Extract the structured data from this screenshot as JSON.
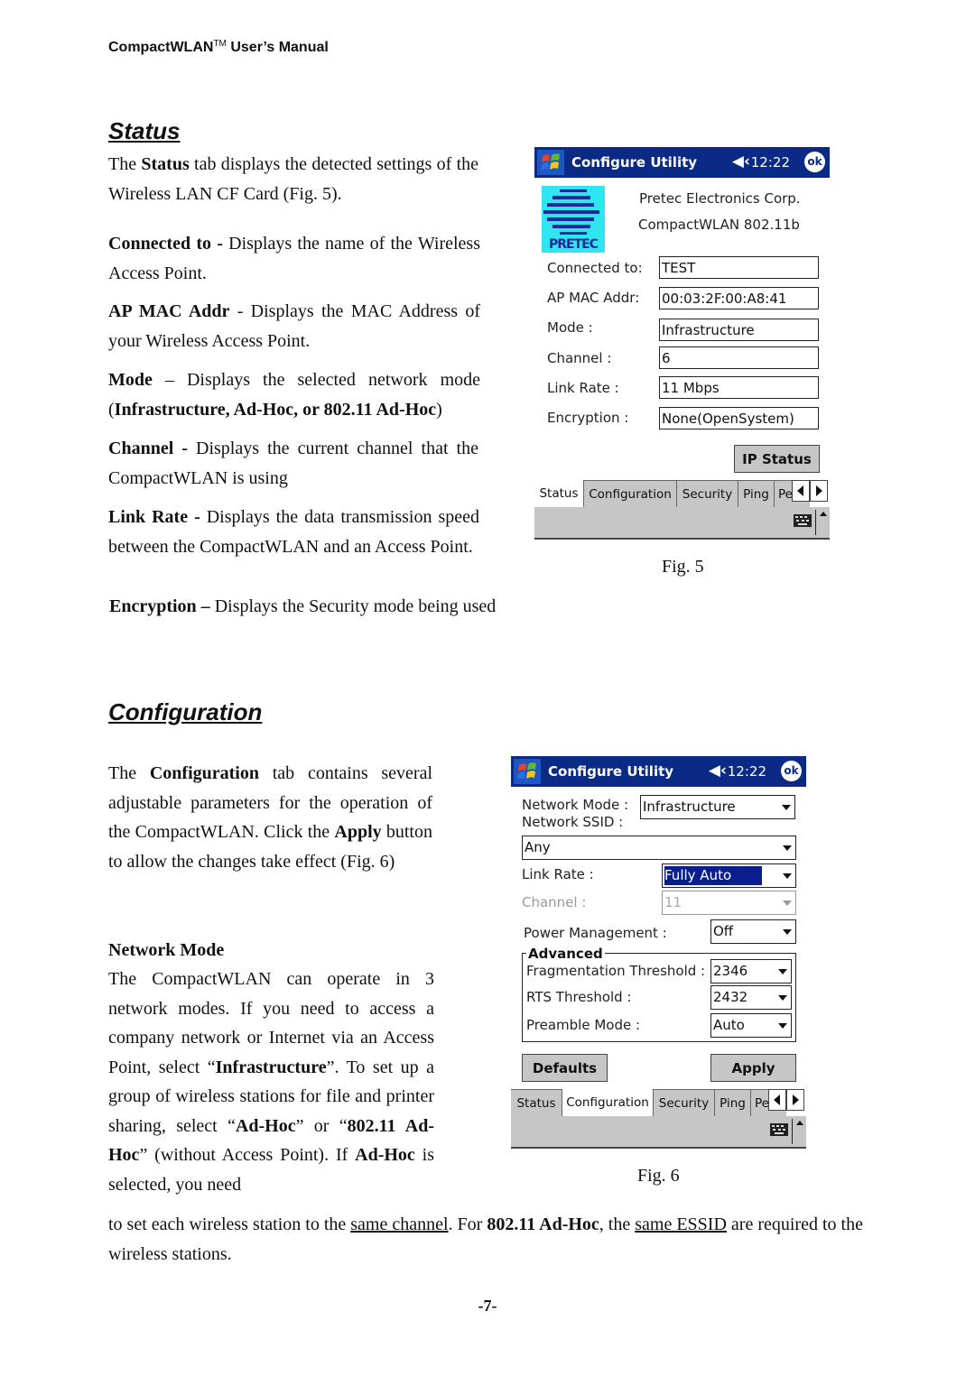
{
  "header": {
    "title": "CompactWLAN",
    "tm": "TM",
    "rest": " User’s Manual"
  },
  "status_section": {
    "title": "Status",
    "intro": [
      "The ",
      "Status",
      " tab displays the detected settings of the Wireless LAN CF Card (Fig. 5)."
    ],
    "items": [
      {
        "term": "Connected to -",
        "desc": " Displays the name of the Wireless Access Point."
      },
      {
        "term": "AP MAC Addr",
        "desc": " - Displays the MAC Address of your Wireless Access Point."
      },
      {
        "term": "Mode",
        "desc": " – Displays the selected network mode (",
        "bold2": "Infrastructure, Ad-Hoc, or 802.11 Ad-Hoc",
        "tail": ")"
      },
      {
        "term": "Channel -",
        "desc": " Displays the current channel that the CompactWLAN is using"
      },
      {
        "term": "Link Rate -",
        "desc": " Displays the data transmission speed between the CompactWLAN and an Access Point."
      },
      {
        "term": "Encryption –",
        "desc": " Displays the Security mode being used"
      }
    ],
    "figure_caption": "Fig. 5"
  },
  "fig5": {
    "titlebar": {
      "app": "Configure Utility",
      "time": "12:22",
      "ok": "ok",
      "speaker_icon": "speaker-icon"
    },
    "logo_text": "PRETEC",
    "company": "Pretec Electronics Corp.",
    "product": "CompactWLAN 802.11b",
    "fields": [
      {
        "label": "Connected to:",
        "value": "TEST"
      },
      {
        "label": "AP MAC Addr:",
        "value": "00:03:2F:00:A8:41"
      },
      {
        "label": "Mode :",
        "value": "Infrastructure"
      },
      {
        "label": "Channel :",
        "value": "6"
      },
      {
        "label": "Link Rate :",
        "value": "11 Mbps"
      },
      {
        "label": "Encryption :",
        "value": "None(OpenSystem)"
      }
    ],
    "ip_status_button": "IP Status",
    "tabs": [
      "Status",
      "Configuration",
      "Security",
      "Ping",
      "Pe"
    ],
    "active_tab": "Status"
  },
  "config_section": {
    "title": "Configuration",
    "intro": [
      "The ",
      "Configuration",
      " tab contains several adjustable parameters for the operation of the CompactWLAN. Click the ",
      "Apply",
      " button to allow the changes take effect (Fig. 6)"
    ],
    "network_mode_heading": "Network Mode",
    "network_mode_text": [
      "The CompactWLAN can operate in 3 network modes.  If you need to access a company network or Internet via an Access Point, select “",
      "Infrastructure",
      "”.  To set up a group of wireless stations for file and printer sharing, select “",
      "Ad-Hoc",
      "” or “",
      "802.11 Ad-Hoc",
      "” (without Access Point). If ",
      "Ad-Hoc",
      " is selected, you need"
    ],
    "continuation": [
      "to set each wireless station to the ",
      "same channel",
      ".   For ",
      "802.11 Ad-Hoc",
      ", the ",
      "same ESSID",
      " are required to the wireless stations."
    ],
    "figure_caption": "Fig. 6"
  },
  "fig6": {
    "titlebar": {
      "app": "Configure Utility",
      "time": "12:22",
      "ok": "ok"
    },
    "network_mode_label": "Network Mode :",
    "network_mode_value": "Infrastructure",
    "ssid_label": "Network SSID :",
    "ssid_value": "Any",
    "link_rate_label": "Link Rate :",
    "link_rate_value": "Fully Auto",
    "channel_label": "Channel :",
    "channel_value": "11",
    "power_label": "Power Management :",
    "power_value": "Off",
    "advanced_title": "Advanced",
    "frag_label": "Fragmentation Threshold :",
    "frag_value": "2346",
    "rts_label": "RTS Threshold :",
    "rts_value": "2432",
    "preamble_label": "Preamble Mode :",
    "preamble_value": "Auto",
    "defaults_button": "Defaults",
    "apply_button": "Apply",
    "tabs": [
      "Status",
      "Configuration",
      "Security",
      "Ping",
      "Pe"
    ],
    "active_tab": "Configuration"
  },
  "page_number": "-7-"
}
